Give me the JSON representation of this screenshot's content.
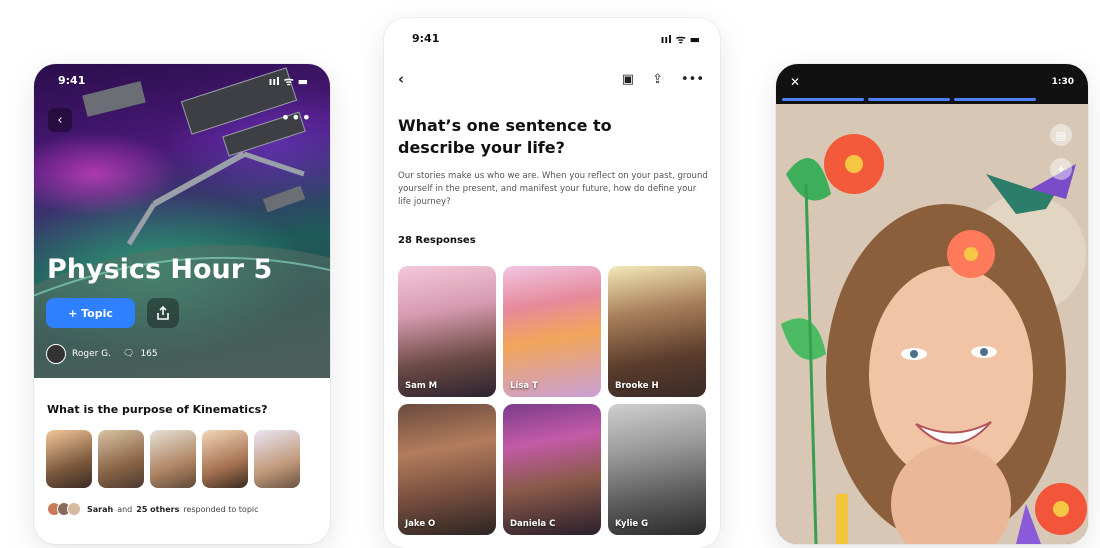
{
  "phone1": {
    "status_time": "9:41",
    "status_icons": "ııl ᯤ ▬",
    "back_icon": "chevron-left-icon",
    "more_label": "•••",
    "title": "Physics Hour 5",
    "topic_button": "+ Topic",
    "author_name": "Roger G.",
    "comment_count": "165",
    "question": "What is the purpose of Kinematics?",
    "responder_names": "Sarah",
    "responder_count": "25 others",
    "responder_suffix": "responded to topic",
    "responder_and": "and"
  },
  "phone2": {
    "status_time": "9:41",
    "status_icons": "ııl ᯤ ▬",
    "heading": "What’s one sentence to describe your life?",
    "description": "Our stories make us who we are. When you reflect on your past, ground yourself in the present, and manifest your future, how do define your life journey?",
    "responses_label": "28 Responses",
    "more_label": "•••",
    "cards": [
      {
        "name": "Sam M"
      },
      {
        "name": "Lisa T"
      },
      {
        "name": "Brooke H"
      },
      {
        "name": "Jake O"
      },
      {
        "name": "Daniela C"
      },
      {
        "name": "Kylie G"
      }
    ]
  },
  "phone3": {
    "close_label": "✕",
    "time_label": "1:30"
  },
  "colors": {
    "accent": "#2f80ff",
    "progress": "#4f7fff"
  }
}
